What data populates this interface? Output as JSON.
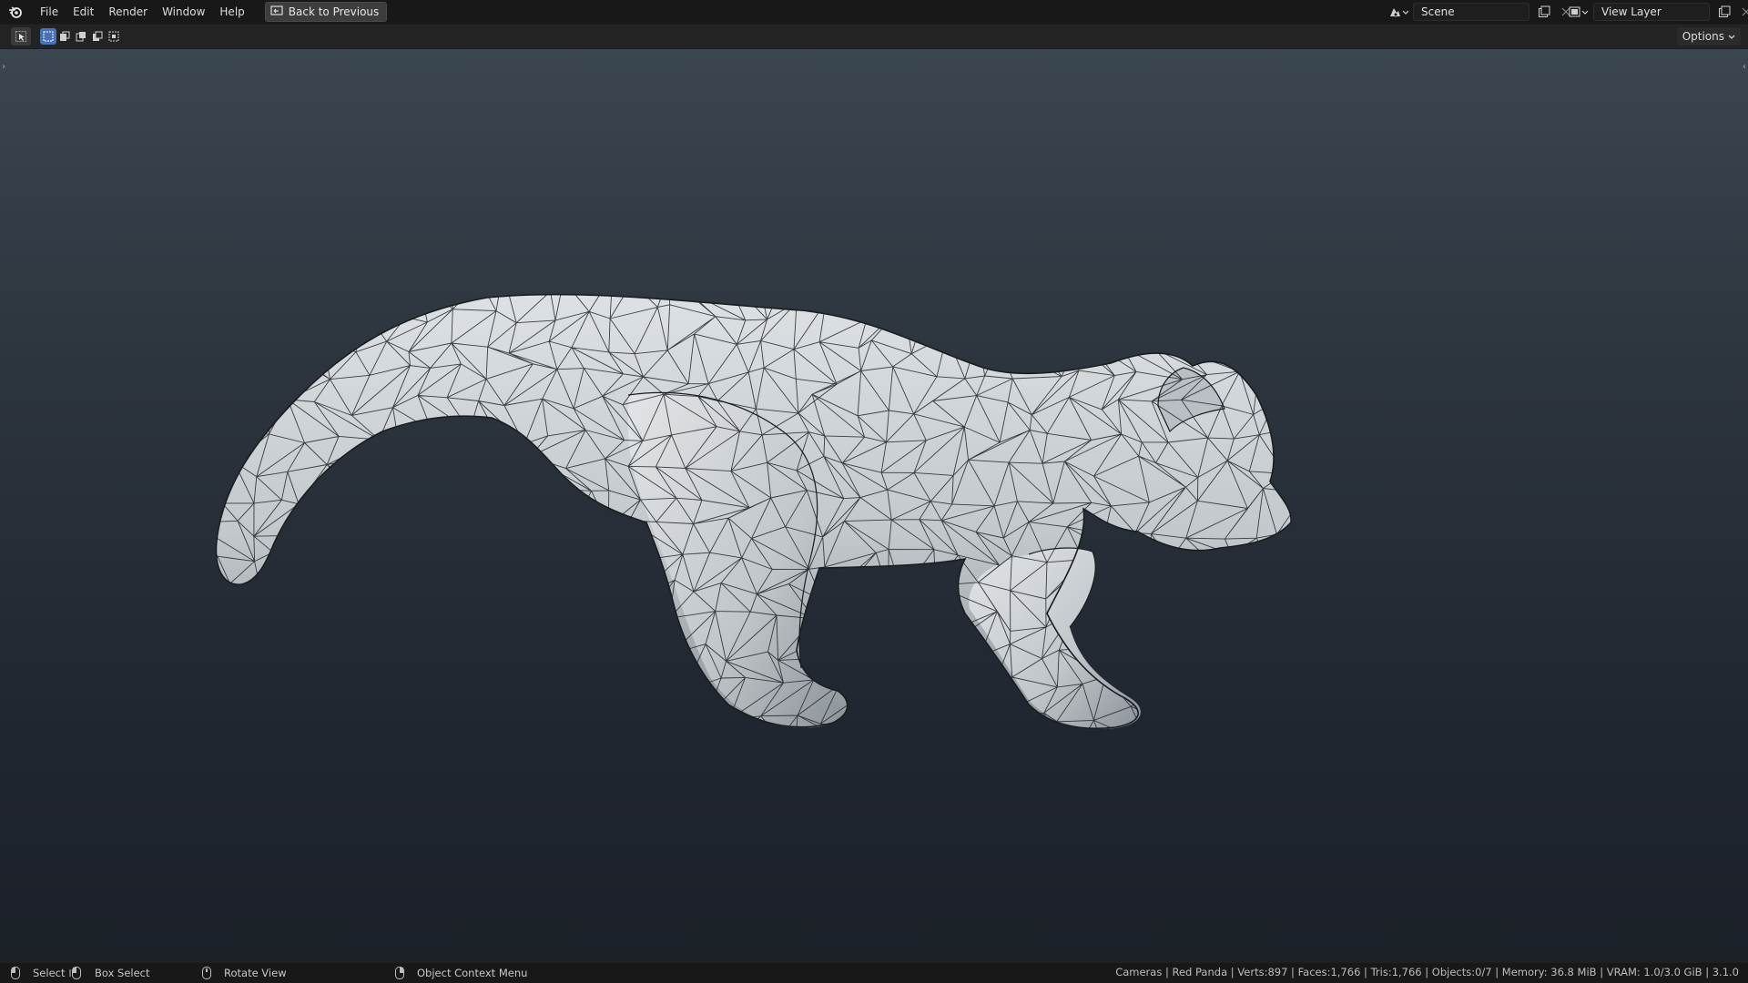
{
  "menubar": {
    "items": [
      "File",
      "Edit",
      "Render",
      "Window",
      "Help"
    ],
    "back_button": "Back to Previous"
  },
  "scene_selector": {
    "value": "Scene"
  },
  "view_layer_selector": {
    "value": "View Layer"
  },
  "header": {
    "options_label": "Options"
  },
  "statusbar": {
    "select": "Select",
    "box_select": "Box Select",
    "rotate_view": "Rotate View",
    "context_menu": "Object Context Menu",
    "stats": "Cameras | Red Panda | Verts:897 | Faces:1,766 | Tris:1,766 | Objects:0/7 | Memory: 36.8 MiB | VRAM: 1.0/3.0 GiB | 3.1.0"
  },
  "colors": {
    "topbar_bg": "#181818",
    "viewport_top": "#3b4650",
    "viewport_bottom": "#1c2128",
    "mesh_surface": "#c9ced2",
    "wire": "#1e2226",
    "accent": "#4772b3"
  }
}
